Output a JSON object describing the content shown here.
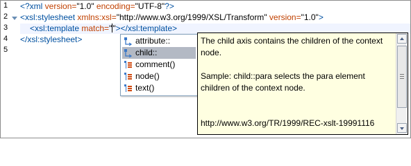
{
  "editor": {
    "line_numbers": [
      "1",
      "2",
      "3",
      "4",
      "5"
    ],
    "lines": {
      "l1": {
        "pi_open": "<?xml",
        "attr1": " version=",
        "val1": "\"1.0\"",
        "attr2": " encoding=",
        "val2": "\"UTF-8\"",
        "pi_close": "?>"
      },
      "l2": {
        "tag_open": "<xsl:stylesheet",
        "attr1": " xmlns:xsl=",
        "val1": "\"http://www.w3.org/1999/XSL/Transform\"",
        "attr2": " version=",
        "val2": "\"1.0\"",
        "tag_close": ">"
      },
      "l3": {
        "tag_open": "<xsl:template",
        "attr1": " match=",
        "val_before_caret": "\"",
        "val_after_caret": "\"",
        "tag_close": ">",
        "close_tag": "</xsl:template>"
      },
      "l4": {
        "close_tag": "</xsl:stylesheet>"
      }
    }
  },
  "completion": {
    "items": [
      {
        "label": "attribute::",
        "icon": "axis-icon",
        "selected": false
      },
      {
        "label": "child::",
        "icon": "axis-icon",
        "selected": true
      },
      {
        "label": "comment()",
        "icon": "node-test-icon",
        "selected": false
      },
      {
        "label": "node()",
        "icon": "node-test-icon",
        "selected": false
      },
      {
        "label": "text()",
        "icon": "node-test-icon",
        "selected": false
      }
    ]
  },
  "documentation": {
    "paragraph1": "The child axis contains the children of the context node.",
    "paragraph2": "Sample: child::para selects the para element children of the context node.",
    "paragraph3": "http://www.w3.org/TR/1999/REC-xslt-19991116"
  },
  "colors": {
    "tag": "#0050a0",
    "attribute": "#c04000",
    "selection": "#b3b9c4",
    "doc_background": "#ffffe1"
  }
}
